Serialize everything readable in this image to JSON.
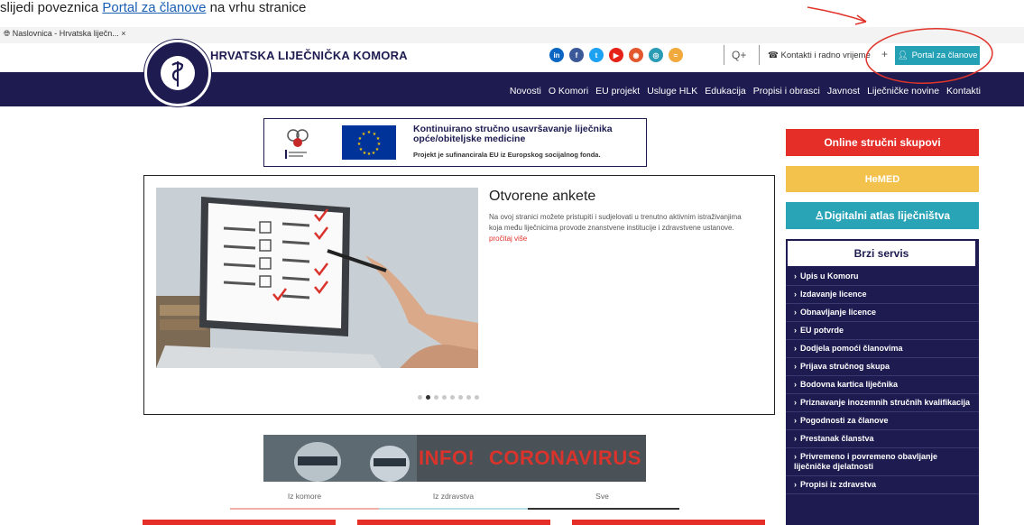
{
  "hint": {
    "before": "slijedi poveznica",
    "link": "Portal za članove",
    "after": "na vrhu stranice"
  },
  "browser": {
    "tab_title": "Naslovnica - Hrvatska liječn... ×"
  },
  "header": {
    "brand": "HRVATSKA LIJEČNIČKA KOMORA",
    "logo_ring_text": "HRVATSKA LIJEČNIČKA KOMORA",
    "socials": [
      {
        "icon": "linkedin-icon",
        "label": "in",
        "color": "#0a66c2"
      },
      {
        "icon": "facebook-icon",
        "label": "f",
        "color": "#3b5998"
      },
      {
        "icon": "twitter-icon",
        "label": "t",
        "color": "#1da1f2"
      },
      {
        "icon": "youtube-icon",
        "label": "▶",
        "color": "#e62117"
      },
      {
        "icon": "podcast-icon",
        "label": "◉",
        "color": "#e2572e"
      },
      {
        "icon": "instagram-icon",
        "label": "◎",
        "color": "#2a9bb5"
      },
      {
        "icon": "rss-icon",
        "label": "≈",
        "color": "#f2a93b"
      }
    ],
    "search_label": "Q+",
    "contact_label": "Kontakti i radno vrijeme",
    "plus_label": "+",
    "portal_label": "Portal za članove"
  },
  "nav": [
    "Novosti",
    "O Komori",
    "EU projekt",
    "Usluge HLK",
    "Edukacija",
    "Propisi i obrasci",
    "Javnost",
    "Liječničke novine",
    "Kontakti"
  ],
  "eu_banner": {
    "line1": "Kontinuirano stručno usavršavanje liječnika",
    "line2": "opće/obiteljske medicine",
    "line3": "Projekt je sufinancirala EU iz Europskog socijalnog fonda."
  },
  "slide": {
    "title": "Otvorene ankete",
    "text": "Na ovoj stranici možete pristupiti i sudjelovati u trenutno aktivnim istraživanjima koja među liječnicima provode znanstvene institucije i zdravstvene ustanove.",
    "more": "pročitaj više",
    "dots_total": 8,
    "dots_active": 2
  },
  "corona": {
    "info": "INFO!",
    "label": "CORONAVIRUS"
  },
  "news_tabs": [
    "Iz komore",
    "Iz zdravstva",
    "Sve"
  ],
  "sidebar": {
    "online": "Online stručni skupovi",
    "hemed": "HeMED",
    "atlas": "Digitalni atlas liječništva",
    "brzi_title": "Brzi servis",
    "items": [
      "Upis u Komoru",
      "Izdavanje licence",
      "Obnavljanje licence",
      "EU potvrde",
      "Dodjela pomoći članovima",
      "Prijava stručnog skupa",
      "Bodovna kartica liječnika",
      "Priznavanje inozemnih stručnih kvalifikacija",
      "Pogodnosti za članove",
      "Prestanak članstva",
      "Privremeno i povremeno obavljanje liječničke djelatnosti",
      "Propisi iz zdravstva"
    ]
  },
  "colors": {
    "navy": "#1d1b4f",
    "teal": "#29a3b6",
    "red": "#e42e27",
    "yellow": "#f2c24d",
    "annotation": "#e0342b"
  }
}
